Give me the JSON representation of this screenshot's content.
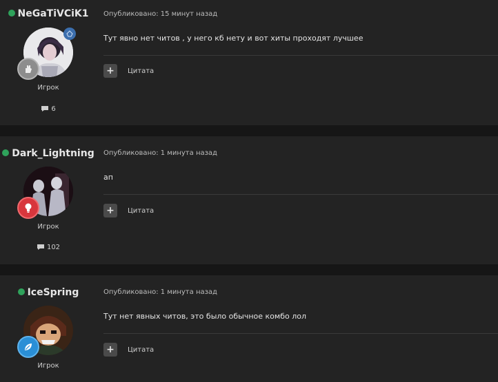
{
  "posts": [
    {
      "username": "NeGaTiVCiK1",
      "published": "Опубликовано: 15 минут назад",
      "text": "Тут явно нет читов , у него  кб нету и вот хиты проходят лучшее",
      "role": "Игрок",
      "posts_count": "6",
      "quote_label": "Цитата",
      "rank_icon": "hand-icon",
      "rank_color": "#9a9a9a"
    },
    {
      "username": "Dark_Lightning",
      "published": "Опубликовано: 1 минута назад",
      "text": "ап",
      "role": "Игрок",
      "posts_count": "102",
      "quote_label": "Цитата",
      "rank_icon": "lightbulb-icon",
      "rank_color": "#d8363d"
    },
    {
      "username": "IceSpring",
      "published": "Опубликовано: 1 минута назад",
      "text": "Тут нет явных читов, это было обычное комбо лол",
      "role": "Игрок",
      "posts_count": "",
      "quote_label": "Цитата",
      "rank_icon": "leaf-icon",
      "rank_color": "#2a8fd6"
    }
  ],
  "colors": {
    "online": "#2fa25b",
    "background": "#161616",
    "post_bg": "#232323"
  }
}
